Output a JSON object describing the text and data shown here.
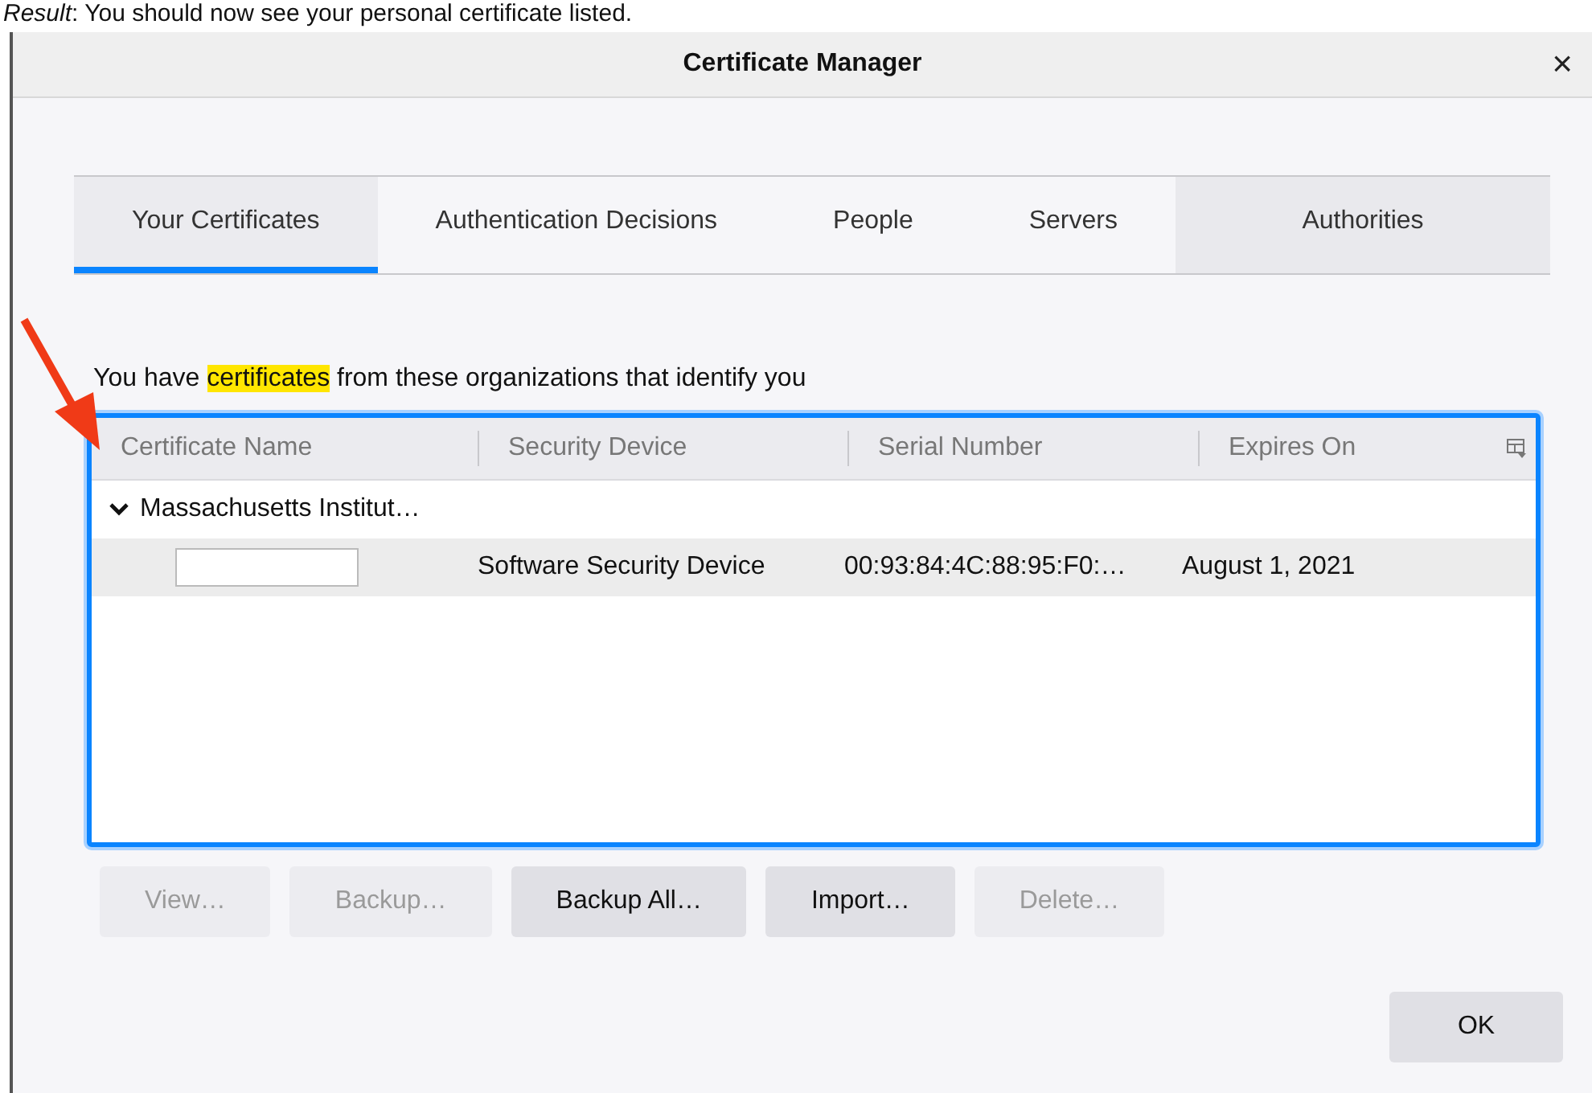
{
  "caption": "*Result*: You should now see your personal certificate listed.",
  "window": {
    "title": "Certificate Manager",
    "close": "×"
  },
  "tabs": [
    {
      "label": "Your Certificates",
      "selected": true,
      "hovered": false
    },
    {
      "label": "Authentication Decisions",
      "selected": false,
      "hovered": false
    },
    {
      "label": "People",
      "selected": false,
      "hovered": false
    },
    {
      "label": "Servers",
      "selected": false,
      "hovered": false
    },
    {
      "label": "Authorities",
      "selected": false,
      "hovered": true
    }
  ],
  "intro": [
    {
      "text": "You have ",
      "highlighted": false
    },
    {
      "text": "certificates",
      "highlighted": true
    },
    {
      "text": " from these organizations that identify you",
      "highlighted": false
    }
  ],
  "table": {
    "columns": [
      "Certificate Name",
      "Security Device",
      "Serial Number",
      "Expires On"
    ],
    "rows": [
      {
        "name": "Massachusetts Institut…",
        "expanded": true,
        "selected": false,
        "children": [
          {
            "name_redacted": true,
            "device": "Software Security Device",
            "serial": "00:93:84:4C:88:95:F0:…",
            "expires": "August 1, 2021",
            "selected": true
          }
        ]
      }
    ]
  },
  "buttons": [
    {
      "label": "View…",
      "disabled": true
    },
    {
      "label": "Backup…",
      "disabled": true
    },
    {
      "label": "Backup All…",
      "disabled": false
    },
    {
      "label": "Import…",
      "disabled": false
    },
    {
      "label": "Delete…",
      "disabled": true
    }
  ],
  "ok_button": "OK"
}
